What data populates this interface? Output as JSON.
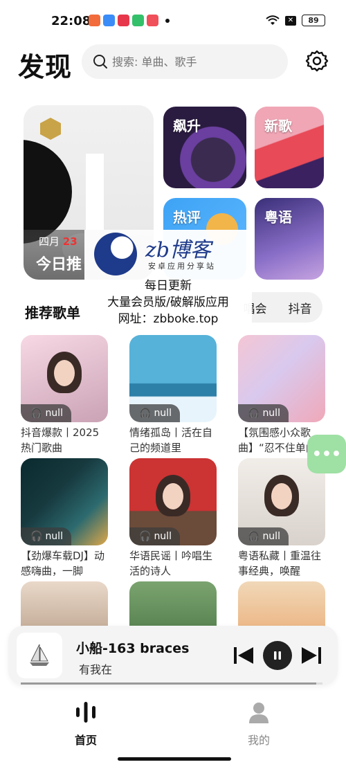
{
  "status_bar": {
    "time": "22:08",
    "battery": "89",
    "app_icon_colors": [
      "#f26b3a",
      "#3b8cf7",
      "#e7374b",
      "#34c06a",
      "#f0505a"
    ]
  },
  "header": {
    "title": "发现",
    "search_placeholder": "搜索: 单曲、歌手"
  },
  "banner": {
    "month": "四月",
    "day": "23",
    "caption": "今日推"
  },
  "tiles": [
    {
      "label": "飙升"
    },
    {
      "label": "新歌"
    },
    {
      "label": "热评"
    },
    {
      "label": "粤语"
    }
  ],
  "section": {
    "title": "推荐歌单",
    "chips": [
      "唱会",
      "抖音"
    ]
  },
  "watermark": {
    "brand": "zb博客",
    "sub": "安卓应用分享站",
    "line1": "每日更新",
    "line2": "大量会员版/破解版应用",
    "line3": "网址：zbboke.top"
  },
  "playlists": [
    {
      "title": "抖音爆款丨2025热门歌曲",
      "play_count": "null"
    },
    {
      "title": "情绪孤岛丨活在自己的频道里",
      "play_count": "null"
    },
    {
      "title": "【氛围感小众歌曲】“忍不住单曲",
      "play_count": "null"
    },
    {
      "title": "【劲爆车载DJ】动感嗨曲，一脚",
      "play_count": "null"
    },
    {
      "title": "华语民谣丨吟唱生活的诗人",
      "play_count": "null"
    },
    {
      "title": "粤语私藏丨重温往事经典，唤醒",
      "play_count": "null"
    }
  ],
  "player": {
    "title": "小船-163 braces",
    "artist": "有我在",
    "progress": 0.98
  },
  "nav": {
    "home": "首页",
    "me": "我的"
  }
}
